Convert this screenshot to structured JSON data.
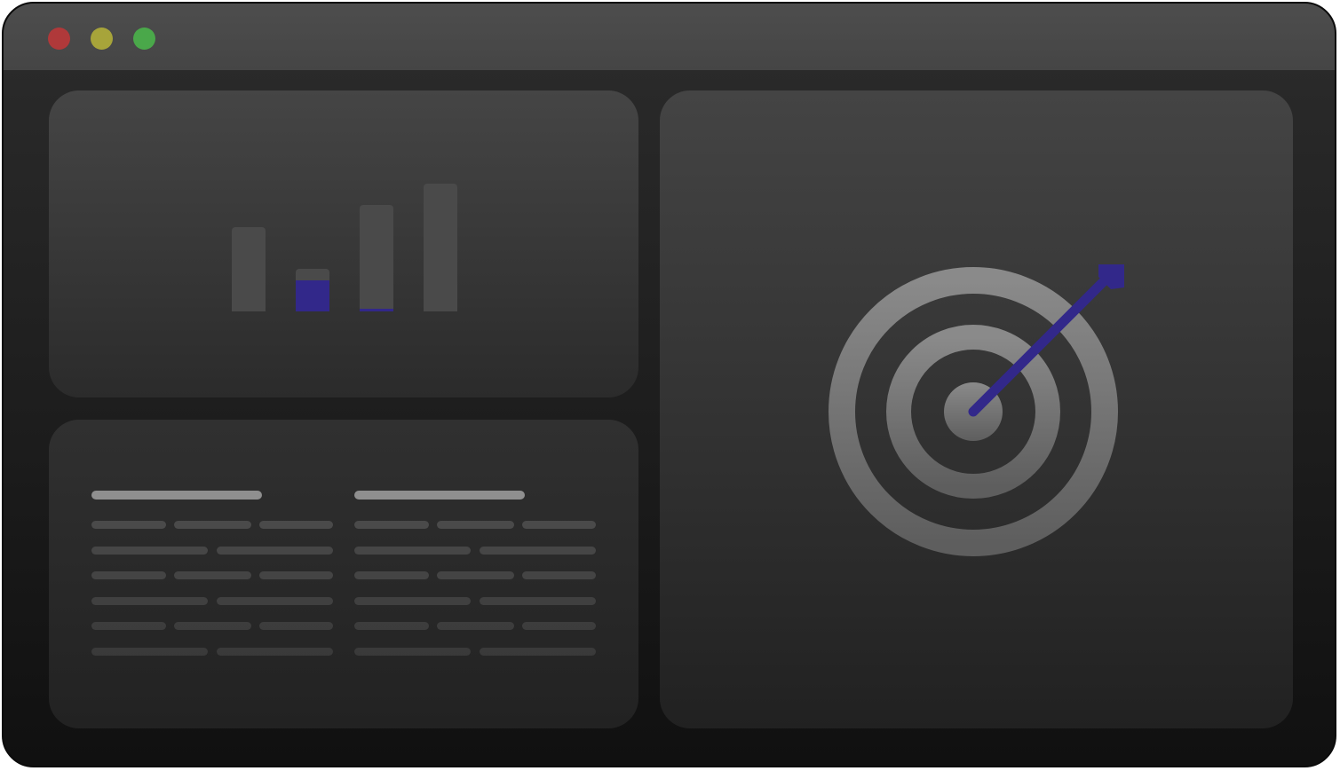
{
  "colors": {
    "close": "#b0393a",
    "minimize": "#a7a43a",
    "maximize": "#4aa84a",
    "accent": "#32288a",
    "ring": "#808080",
    "placeholder_line": "#4a4a4a"
  },
  "window": {
    "controls": [
      "close-icon",
      "minimize-icon",
      "maximize-icon"
    ]
  },
  "chart_data": {
    "type": "bar",
    "categories": [
      "",
      "",
      "",
      ""
    ],
    "series": [
      {
        "values": [
          0.66,
          0.33,
          0.83,
          1.0
        ]
      },
      {
        "values": [
          0,
          0.24,
          0.02,
          0
        ]
      }
    ],
    "title": "",
    "xlabel": "",
    "ylabel": "",
    "grid": false
  },
  "table": {
    "columns": [
      {
        "header_placeholder": true,
        "rows": 6
      },
      {
        "header_placeholder": true,
        "rows": 6
      }
    ]
  },
  "illustration": {
    "icon": "target-with-arrow-icon"
  }
}
